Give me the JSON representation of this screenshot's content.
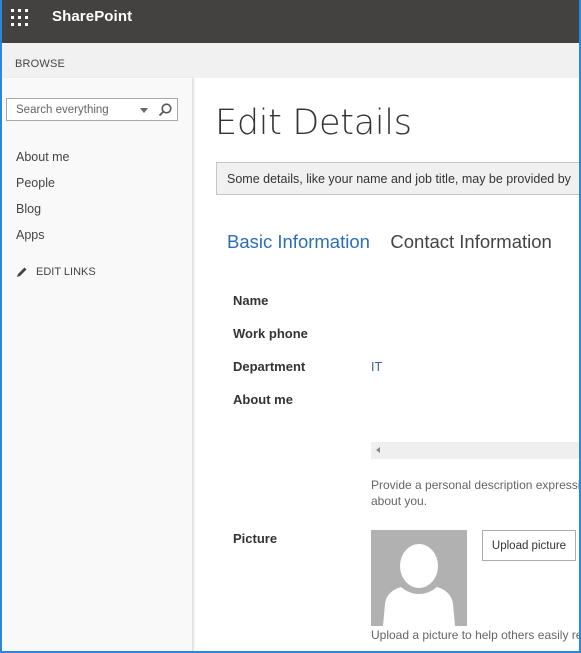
{
  "suite_bar": {
    "app_launcher_icon": "waffle-icon",
    "brand": "SharePoint"
  },
  "ribbon": {
    "browse_label": "BROWSE"
  },
  "sidebar": {
    "search": {
      "placeholder": "Search everything",
      "dropdown_icon": "caret-down-icon",
      "search_icon": "magnifier-icon"
    },
    "nav_items": [
      {
        "label": "About me"
      },
      {
        "label": "People"
      },
      {
        "label": "Blog"
      },
      {
        "label": "Apps"
      }
    ],
    "edit_links": {
      "icon": "pencil-icon",
      "label": "EDIT LINKS"
    }
  },
  "main": {
    "title": "Edit Details",
    "notice": "Some details, like your name and job title, may be provided by",
    "tabs": [
      {
        "label": "Basic Information",
        "active": true
      },
      {
        "label": "Contact Information",
        "active": false
      }
    ],
    "fields": {
      "name": {
        "label": "Name",
        "value": ""
      },
      "work_phone": {
        "label": "Work phone",
        "value": ""
      },
      "department": {
        "label": "Department",
        "value": "IT"
      },
      "about_me": {
        "label": "About me",
        "hint_line1": "Provide a personal description expressing",
        "hint_line2": "about you."
      },
      "picture": {
        "label": "Picture",
        "upload_button": "Upload picture",
        "hint": "Upload a picture to help others easily rec"
      }
    }
  },
  "colors": {
    "suite_bar": "#444240",
    "accent": "#2a6ebb",
    "window_border": "#2b88d8"
  }
}
